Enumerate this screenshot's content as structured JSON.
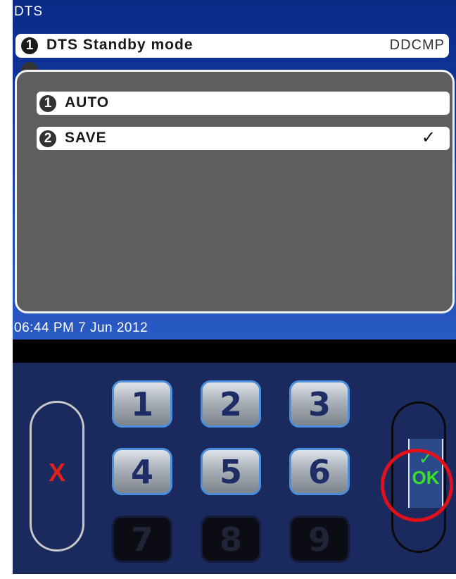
{
  "screen": {
    "title": "DTS",
    "menu_item": {
      "number": "1",
      "label": "DTS Standby mode",
      "value": "DDCMP"
    },
    "dialog": {
      "options": [
        {
          "number": "1",
          "label": "AUTO",
          "selected": false,
          "check": ""
        },
        {
          "number": "2",
          "label": "SAVE",
          "selected": true,
          "check": "✓"
        }
      ]
    },
    "datetime": "06:44 PM 7 Jun 2012"
  },
  "keypad": {
    "cancel_label": "X",
    "keys": [
      {
        "label": "1",
        "enabled": true
      },
      {
        "label": "2",
        "enabled": true
      },
      {
        "label": "3",
        "enabled": true
      },
      {
        "label": "4",
        "enabled": true
      },
      {
        "label": "5",
        "enabled": true
      },
      {
        "label": "6",
        "enabled": true
      },
      {
        "label": "7",
        "enabled": false
      },
      {
        "label": "8",
        "enabled": false
      },
      {
        "label": "9",
        "enabled": false
      }
    ],
    "ok_check": "✓",
    "ok_label": "OK"
  },
  "colors": {
    "screen_blue": "#143ca8",
    "keypad_navy": "#1a2a5e",
    "cancel_red": "#e0201a",
    "ok_green": "#3ce02a",
    "highlight_red": "#e2101a",
    "key_border_blue": "#4b8edc"
  },
  "icons": {
    "cancel": "x-icon",
    "confirm": "checkmark-icon",
    "selected_option": "checkmark-icon"
  }
}
